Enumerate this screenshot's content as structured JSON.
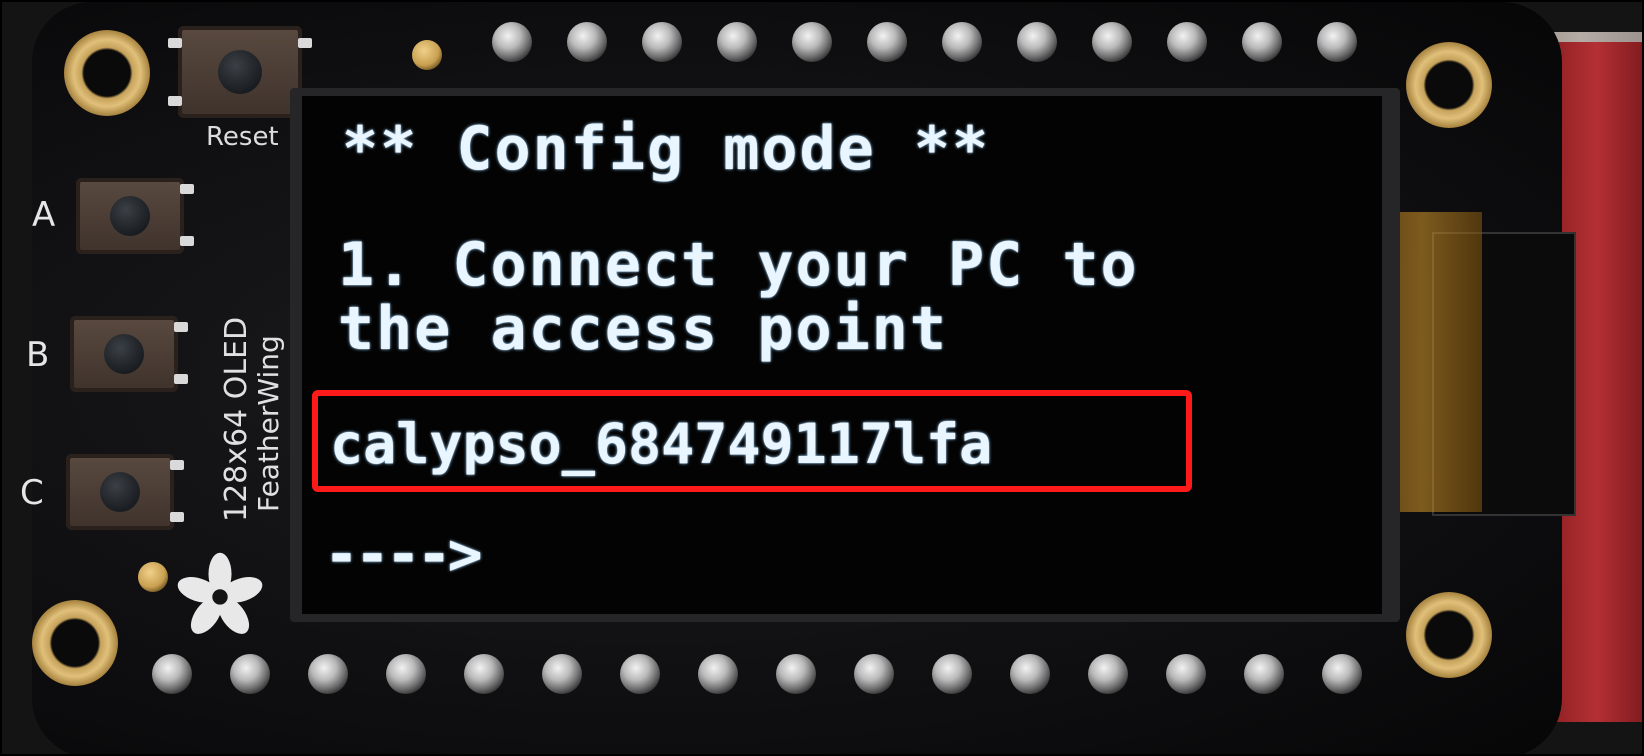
{
  "board": {
    "reset_label": "Reset",
    "button_labels": [
      "A",
      "B",
      "C"
    ],
    "silkscreen_lines": [
      "128x64 OLED",
      "FeatherWing"
    ]
  },
  "oled": {
    "title": "** Config mode **",
    "instruction_line1": "1. Connect your PC to",
    "instruction_line2": "the access point",
    "ssid": "calypso_684749117lfa",
    "arrow": "---->"
  },
  "colors": {
    "highlight": "#ff1a1a",
    "oled_text": "#eaf6ff",
    "board": "#111113"
  },
  "icons": {
    "logo": "adafruit-flower-icon"
  }
}
